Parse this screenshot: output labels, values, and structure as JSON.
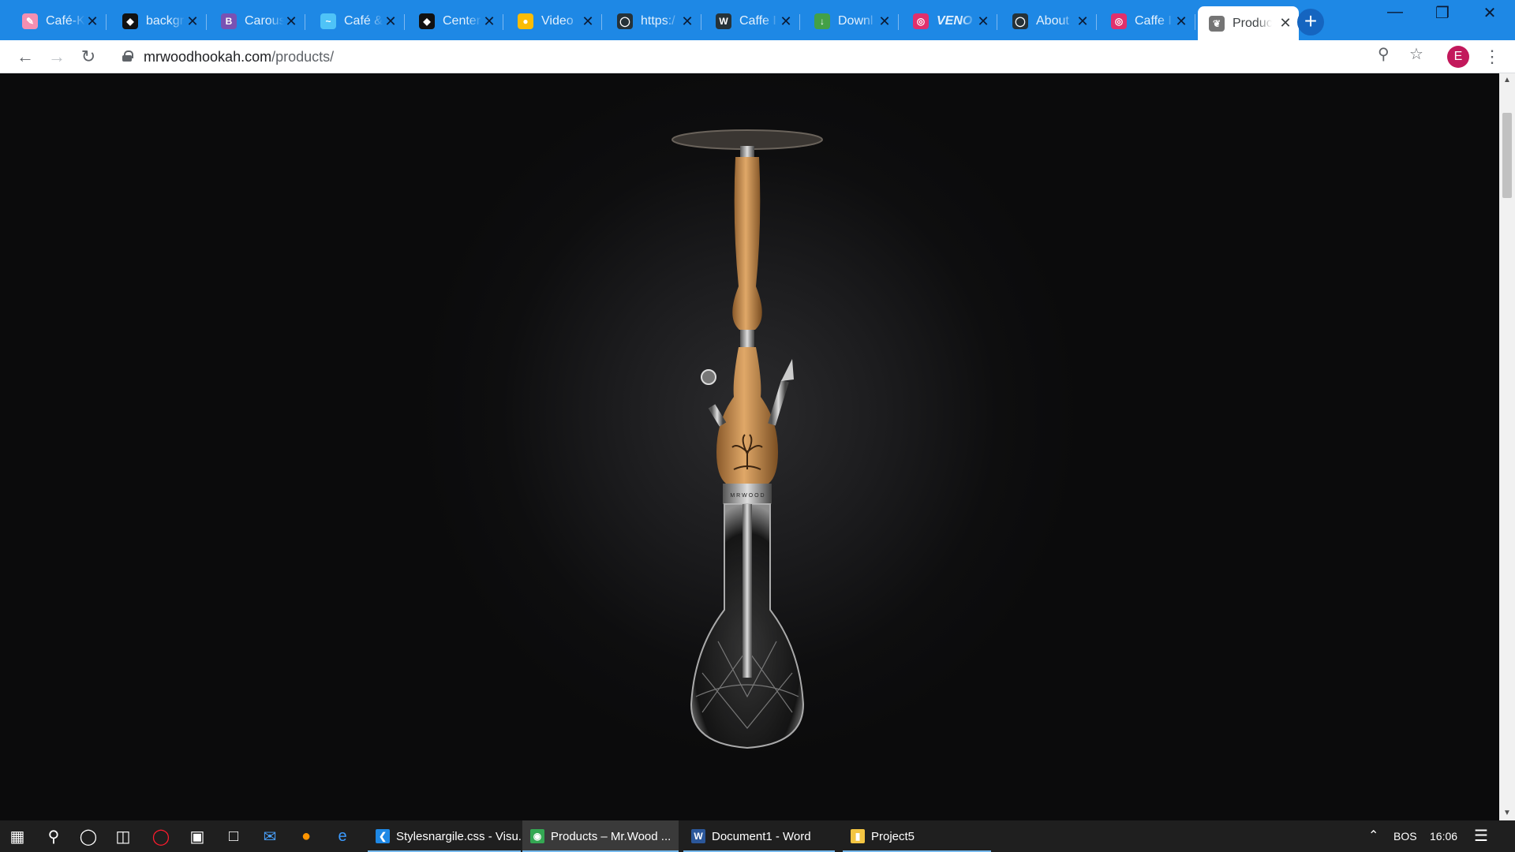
{
  "browser": {
    "tabs": [
      {
        "title": "Café-K",
        "icon": "cafe-k-favicon",
        "color": "#f48fb1"
      },
      {
        "title": "backgr",
        "icon": "codepen-favicon",
        "color": "#111111"
      },
      {
        "title": "Carous",
        "icon": "bootstrap-favicon",
        "color": "#7952b3"
      },
      {
        "title": "Café &",
        "icon": "cafe-favicon",
        "color": "#4fc3f7"
      },
      {
        "title": "Center",
        "icon": "codepen-favicon",
        "color": "#111111"
      },
      {
        "title": "Video",
        "icon": "google-photos-favicon",
        "color": "#fbbc04"
      },
      {
        "title": "https:/",
        "icon": "site-favicon",
        "color": "#263238"
      },
      {
        "title": "Caffe I",
        "icon": "wordpress-favicon",
        "color": "#263238"
      },
      {
        "title": "Downl",
        "icon": "download-favicon",
        "color": "#43a047"
      },
      {
        "title": "VENO",
        "icon": "instagram-favicon",
        "color": "#e1306c"
      },
      {
        "title": "About",
        "icon": "site-favicon",
        "color": "#263238"
      },
      {
        "title": "Caffe I",
        "icon": "instagram-favicon",
        "color": "#e1306c"
      },
      {
        "title": "Produc",
        "icon": "mrwood-favicon",
        "color": "#757575",
        "active": true
      }
    ],
    "new_tab": "+",
    "window_controls": {
      "minimize": "—",
      "restore": "❐",
      "close": "✕"
    },
    "url_host": "mrwoodhookah.com",
    "url_path": "/products/",
    "profile_initial": "E"
  },
  "page": {
    "product_image": "mr-wood-hookah",
    "base_engraving": "M R W O O D"
  },
  "taskbar": {
    "apps": [
      {
        "label": "Stylesnargile.css - Visu...",
        "icon": "vscode-icon",
        "color": "#1e88e5"
      },
      {
        "label": "Products – Mr.Wood ...",
        "icon": "chrome-icon",
        "color": "#34a853",
        "current": true
      },
      {
        "label": "Document1 - Word",
        "icon": "word-icon",
        "color": "#2b579a"
      },
      {
        "label": "Project5",
        "icon": "folder-icon",
        "color": "#f4c542"
      }
    ],
    "language": "BOS",
    "time": "16:06"
  }
}
